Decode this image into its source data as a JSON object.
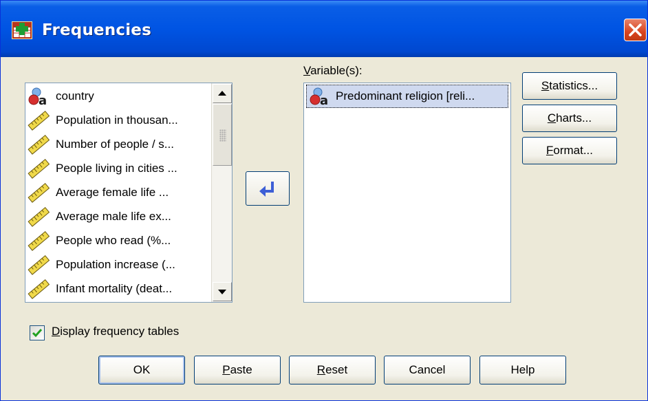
{
  "window": {
    "title": "Frequencies"
  },
  "variable_list": {
    "items": [
      {
        "label": "country",
        "type": "nominal"
      },
      {
        "label": "Population in thousan...",
        "type": "scale"
      },
      {
        "label": "Number of people / s...",
        "type": "scale"
      },
      {
        "label": "People living in cities ...",
        "type": "scale"
      },
      {
        "label": "Average female life ...",
        "type": "scale"
      },
      {
        "label": "Average male life ex...",
        "type": "scale"
      },
      {
        "label": "People who read (%...",
        "type": "scale"
      },
      {
        "label": "Population increase (...",
        "type": "scale"
      },
      {
        "label": "Infant mortality (deat...",
        "type": "scale"
      }
    ]
  },
  "target": {
    "label_mnemonic": "V",
    "label_rest": "ariable(s):",
    "items": [
      {
        "label": "Predominant religion [reli...",
        "type": "nominal"
      }
    ]
  },
  "side_buttons": [
    {
      "mnemonic": "S",
      "rest": "tatistics..."
    },
    {
      "mnemonic": "C",
      "rest": "harts..."
    },
    {
      "mnemonic": "F",
      "rest": "ormat..."
    }
  ],
  "checkbox": {
    "mnemonic": "D",
    "rest": "isplay frequency tables",
    "checked": true
  },
  "bottom_buttons": {
    "ok": "OK",
    "paste_m": "P",
    "paste_r": "aste",
    "reset_m": "R",
    "reset_r": "eset",
    "cancel": "Cancel",
    "help": "Help"
  },
  "colors": {
    "titlebar": "#0054e3",
    "face": "#ece9d8",
    "selection": "#cfd9ef",
    "arrow": "#3d5fd6"
  }
}
